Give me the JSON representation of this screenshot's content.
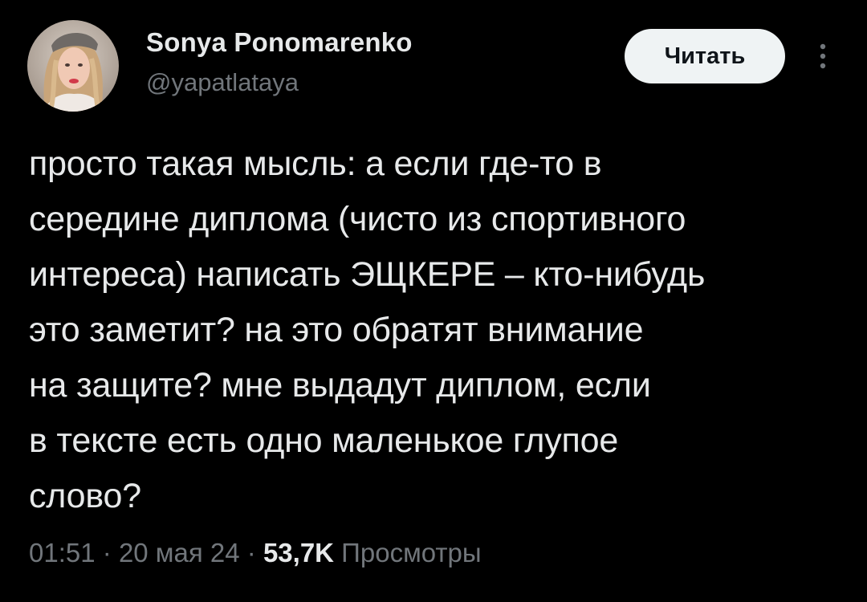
{
  "author": {
    "name": "Sonya Ponomarenko",
    "handle": "@yapatlataya"
  },
  "follow_button": {
    "label": "Читать"
  },
  "more_icon": "more-vertical-icon",
  "tweet": {
    "text": "просто такая мысль: а если где-то в\nсередине диплома (чисто из спортивного\nинтереса) написать ЭЩКЕРЕ – кто-нибудь\nэто заметит? на это обратят внимание\nна защите? мне выдадут диплом, если\nв тексте есть одно маленькое глупое\nслово?"
  },
  "meta": {
    "time": "01:51",
    "separator": "·",
    "date": "20 мая 24",
    "views_count": "53,7K",
    "views_label": "Просмотры"
  },
  "colors": {
    "background": "#000000",
    "text": "#e7e9ea",
    "secondary_text": "#71767b",
    "button_bg": "#eff3f4",
    "button_text": "#0f1419"
  }
}
